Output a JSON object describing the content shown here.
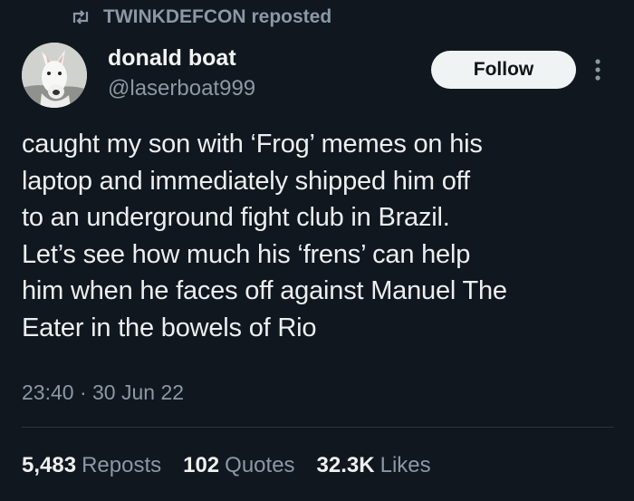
{
  "repost_banner": {
    "user": "TWINKDEFCON",
    "suffix": "reposted"
  },
  "author": {
    "display_name": "donald boat",
    "handle": "@laserboat999"
  },
  "actions": {
    "follow_label": "Follow"
  },
  "post": {
    "lines": [
      "caught my son with ‘Frog’ memes on his",
      "laptop and immediately shipped him off",
      "to an underground fight club in Brazil.",
      "Let’s see how much his ‘frens’ can help",
      "him when he faces off against Manuel The",
      "Eater in the bowels of Rio"
    ],
    "timestamp": "23:40 · 30 Jun 22"
  },
  "stats": [
    {
      "count": "5,483",
      "label": "Reposts"
    },
    {
      "count": "102",
      "label": "Quotes"
    },
    {
      "count": "32.3K",
      "label": "Likes"
    }
  ],
  "icons": {
    "repost": "repost-icon",
    "more": "more-vertical-icon",
    "avatar": "dog-avatar"
  },
  "colors": {
    "background": "#10171e",
    "primary_text": "#e7e9ea",
    "secondary_text": "#8b98a5",
    "follow_button": "#eff3f4",
    "divider": "#2f3336"
  }
}
